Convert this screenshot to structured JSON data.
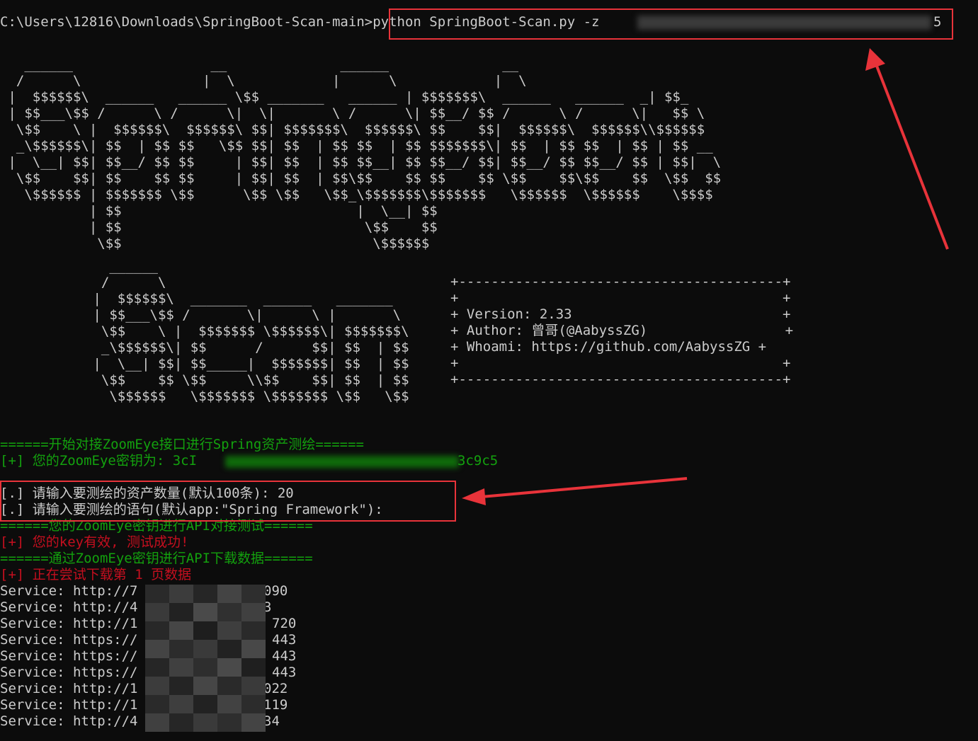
{
  "command": {
    "prompt": "C:\\Users\\12816\\Downloads\\SpringBoot-Scan-main>",
    "text": "python SpringBoot-Scan.py -z ",
    "tail": "5"
  },
  "banner_art": {
    "spring": "   ______                 __              ______              __\n  /      \\               |  \\            |      \\            |  \\\n |  $$$$$$\\  ______   ______ \\$$ _______   ______ | $$$$$$$\\  ______   ______  _| $$_\n | $$___\\$$ /      \\ /      \\|  \\|       \\ /      \\| $$__/ $$ /      \\ /      \\|   $$ \\\n  \\$$    \\ |  $$$$$$\\  $$$$$$\\ $$| $$$$$$$\\  $$$$$$\\ $$    $$|  $$$$$$\\  $$$$$$\\\\$$$$$$\n  _\\$$$$$$\\| $$  | $$ $$   \\$$ $$| $$  | $$ $$  | $$ $$$$$$$\\| $$  | $$ $$  | $$ | $$ __\n |  \\__| $$| $$__/ $$ $$     | $$| $$  | $$ $$__| $$ $$__/ $$| $$__/ $$ $$__/ $$ | $$|  \\\n  \\$$    $$| $$    $$ $$     | $$| $$  | $$\\$$    $$ $$    $$ \\$$    $$\\$$    $$  \\$$  $$\n   \\$$$$$$ | $$$$$$$ \\$$      \\$$ \\$$   \\$$_\\$$$$$$$\\$$$$$$$   \\$$$$$$  \\$$$$$$    \\$$$$\n           | $$                             |  \\__| $$\n           | $$                              \\$$    $$\n            \\$$                               \\$$$$$$",
    "scan": "   ______\n  /      \\\n |  $$$$$$\\  _______  ______   _______\n | $$___\\$$ /       \\|      \\ |       \\\n  \\$$    \\ |  $$$$$$$ \\$$$$$$\\| $$$$$$$\\\n  _\\$$$$$$\\| $$      /      $$| $$  | $$\n |  \\__| $$| $$_____|  $$$$$$$| $$  | $$\n  \\$$    $$ \\$$     \\\\$$    $$| $$  | $$\n   \\$$$$$$   \\$$$$$$$ \\$$$$$$$ \\$$   \\$$"
  },
  "info_box": {
    "border": "+----------------------------------------+",
    "blank": "+                                        +",
    "version": "+ Version: 2.33                          +",
    "author": "+ Author: 曾哥(@AabyssZG)                 +",
    "whoami": "+ Whoami: https://github.com/AabyssZG +"
  },
  "log": {
    "start_zoomeye": "======开始对接ZoomEye接口进行Spring资产测绘======",
    "key_prefix": "[+] 您的ZoomEye密钥为: 3cI",
    "key_suffix": "3c9c5",
    "ask_count": "[.] 请输入要测绘的资产数量(默认100条): 20",
    "ask_query": "[.] 请输入要测绘的语句(默认app:\"Spring Framework\"):",
    "api_test": "======您的ZoomEye密钥进行API对接测试======",
    "key_ok": "[+] 您的key有效, 测试成功!",
    "download_api": "======通过ZoomEye密钥进行API下载数据======",
    "downloading": "[+] 正在尝试下载第 1 页数据"
  },
  "services": [
    {
      "prefix": "Service: http://7",
      "suffix": "090"
    },
    {
      "prefix": "Service: http://4",
      "suffix": "3"
    },
    {
      "prefix": "Service: http://1",
      "suffix": "720"
    },
    {
      "prefix": "Service: https://",
      "suffix": "443"
    },
    {
      "prefix": "Service: https://",
      "suffix": "443"
    },
    {
      "prefix": "Service: https://",
      "suffix": "443"
    },
    {
      "prefix": "Service: http://1",
      "suffix": "022"
    },
    {
      "prefix": "Service: http://1",
      "suffix": "119"
    },
    {
      "prefix": "Service: http://4",
      "suffix": "34"
    }
  ],
  "colors": {
    "background": "#0c0c0c",
    "text": "#cccccc",
    "green": "#13a10e",
    "red": "#c50f1f",
    "highlight": "#e8333a"
  }
}
